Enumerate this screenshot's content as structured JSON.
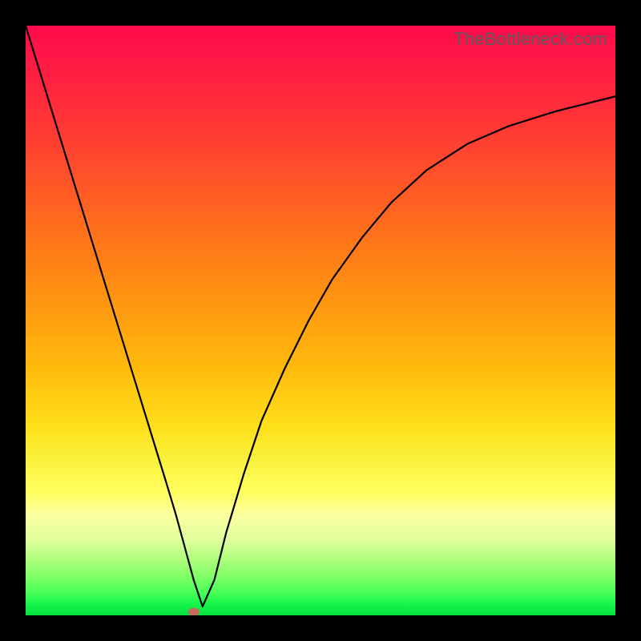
{
  "watermark": "TheBottleneck.com",
  "chart_data": {
    "type": "line",
    "title": "",
    "xlabel": "",
    "ylabel": "",
    "xlim": [
      0,
      100
    ],
    "ylim": [
      0,
      100
    ],
    "grid": false,
    "legend": false,
    "background_gradient": [
      "#ff0a4c",
      "#06e03e"
    ],
    "series": [
      {
        "name": "bottleneck-curve",
        "x": [
          0,
          2,
          4,
          6,
          8,
          10,
          12,
          14,
          16,
          18,
          20,
          22,
          24,
          25.5,
          27,
          28.5,
          30,
          32,
          34,
          37,
          40,
          44,
          48,
          52,
          57,
          62,
          68,
          75,
          82,
          90,
          100
        ],
        "y": [
          100,
          93.5,
          87,
          80.5,
          74,
          67.5,
          61,
          54.5,
          48,
          41.5,
          35,
          28.5,
          22,
          17,
          11.5,
          6,
          1.5,
          6,
          14,
          24,
          33,
          42,
          50,
          57,
          64,
          70,
          75.5,
          80,
          83,
          85.5,
          88
        ]
      }
    ],
    "marker": {
      "x": 28.5,
      "y": 0.6,
      "color": "#c96a5f",
      "shape": "ellipse"
    }
  }
}
